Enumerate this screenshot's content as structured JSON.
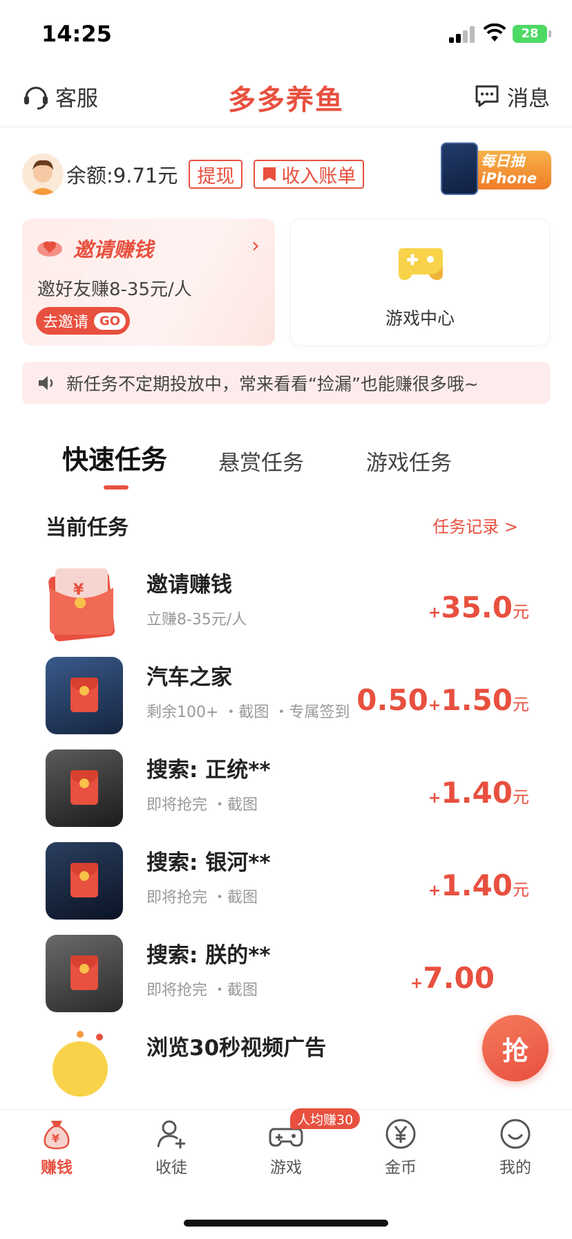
{
  "status_bar": {
    "time": "14:25",
    "battery": "28"
  },
  "header": {
    "service_label": "客服",
    "title": "多多养鱼",
    "message_label": "消息"
  },
  "balance": {
    "text": "余额:9.71元",
    "withdraw_label": "提现",
    "bill_label": "收入账单",
    "lottery_text": "每日抽 iPhone"
  },
  "invite_card": {
    "title": "邀请赚钱",
    "subtitle": "邀好友赚8-35元/人",
    "cta": "去邀请",
    "go": "GO"
  },
  "game_card": {
    "label": "游戏中心"
  },
  "notice": {
    "text": "新任务不定期投放中，常来看看“捡漏”也能赚很多哦~"
  },
  "tabs": [
    {
      "label": "快速任务",
      "active": true
    },
    {
      "label": "悬赏任务",
      "active": false
    },
    {
      "label": "游戏任务",
      "active": false
    }
  ],
  "task_panel": {
    "title": "当前任务",
    "record_link": "任务记录 >",
    "tasks": [
      {
        "title": "邀请赚钱",
        "meta": "立赚8-35元/人",
        "price_prefix": "",
        "plus": "+",
        "price": "35.0",
        "unit": "元"
      },
      {
        "title": "汽车之家",
        "meta": "剩余100+ ・截图 ・专属签到",
        "price_prefix": "0.50",
        "plus": "+",
        "price": "1.50",
        "unit": "元"
      },
      {
        "title": "搜索: 正统**",
        "meta": "即将抢完 ・截图",
        "price_prefix": "",
        "plus": "+",
        "price": "1.40",
        "unit": "元"
      },
      {
        "title": "搜索: 银河**",
        "meta": "即将抢完 ・截图",
        "price_prefix": "",
        "plus": "+",
        "price": "1.40",
        "unit": "元"
      },
      {
        "title": "搜索: 朕的**",
        "meta": "即将抢完 ・截图",
        "price_prefix": "",
        "plus": "+",
        "price": "7.00",
        "unit": ""
      },
      {
        "title": "浏览30秒视频广告",
        "meta": "",
        "price_prefix": "",
        "plus": "",
        "price": "",
        "unit": ""
      }
    ]
  },
  "grab_button": "抢",
  "bottom_nav": {
    "items": [
      {
        "label": "赚钱",
        "icon": "money-bag-icon",
        "active": true
      },
      {
        "label": "收徒",
        "icon": "add-user-icon",
        "active": false
      },
      {
        "label": "游戏",
        "icon": "gamepad-icon",
        "active": false
      },
      {
        "label": "金币",
        "icon": "yen-coin-icon",
        "active": false
      },
      {
        "label": "我的",
        "icon": "smile-icon",
        "active": false
      }
    ],
    "badge": "人均赚30"
  },
  "colors": {
    "accent": "#e8503f",
    "notice_bg": "#fdeceb",
    "game_icon": "#f8d34a"
  }
}
